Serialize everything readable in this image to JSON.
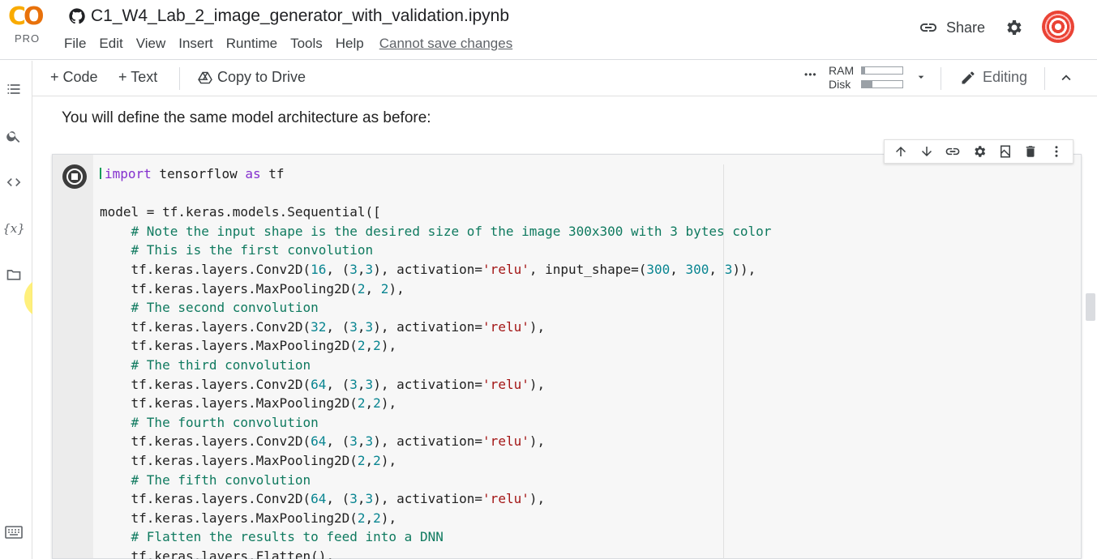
{
  "app": {
    "logo": {
      "letters": "CO",
      "tier": "PRO",
      "colors": {
        "c": "#f9ab00",
        "o": "#e8710a"
      }
    },
    "notebook_title": "C1_W4_Lab_2_image_generator_with_validation.ipynb",
    "title_icon": "github-icon"
  },
  "menu": {
    "items": [
      "File",
      "Edit",
      "View",
      "Insert",
      "Runtime",
      "Tools",
      "Help"
    ],
    "status": "Cannot save changes"
  },
  "header_actions": {
    "share_label": "Share",
    "share_icon": "link-icon",
    "settings_icon": "gear-icon",
    "avatar": "account-avatar"
  },
  "toolbar": {
    "add_code": "+ Code",
    "add_text": "+ Text",
    "copy_to_drive": "Copy to Drive",
    "more": "•••",
    "ram_label": "RAM",
    "disk_label": "Disk",
    "ram_usage": 0.08,
    "disk_usage": 0.25,
    "editing_label": "Editing"
  },
  "rail": {
    "icons": [
      "toc-icon",
      "search-icon",
      "code-snippets-icon",
      "variables-icon",
      "files-icon",
      "terminal-icon"
    ],
    "variables_glyph": "{x}"
  },
  "text_cell": "You will define the same model architecture as before:",
  "cell_toolbar": [
    "move-up-icon",
    "move-down-icon",
    "link-icon",
    "settings-icon",
    "mirror-cell-icon",
    "delete-icon",
    "more-icon"
  ],
  "code_lines": [
    "import tensorflow as tf",
    "",
    "model = tf.keras.models.Sequential([",
    "    # Note the input shape is the desired size of the image 300x300 with 3 bytes color",
    "    # This is the first convolution",
    "    tf.keras.layers.Conv2D(16, (3,3), activation='relu', input_shape=(300, 300, 3)),",
    "    tf.keras.layers.MaxPooling2D(2, 2),",
    "    # The second convolution",
    "    tf.keras.layers.Conv2D(32, (3,3), activation='relu'),",
    "    tf.keras.layers.MaxPooling2D(2,2),",
    "    # The third convolution",
    "    tf.keras.layers.Conv2D(64, (3,3), activation='relu'),",
    "    tf.keras.layers.MaxPooling2D(2,2),",
    "    # The fourth convolution",
    "    tf.keras.layers.Conv2D(64, (3,3), activation='relu'),",
    "    tf.keras.layers.MaxPooling2D(2,2),",
    "    # The fifth convolution",
    "    tf.keras.layers.Conv2D(64, (3,3), activation='relu'),",
    "    tf.keras.layers.MaxPooling2D(2,2),",
    "    # Flatten the results to feed into a DNN",
    "    tf.keras.layers.Flatten(),"
  ]
}
